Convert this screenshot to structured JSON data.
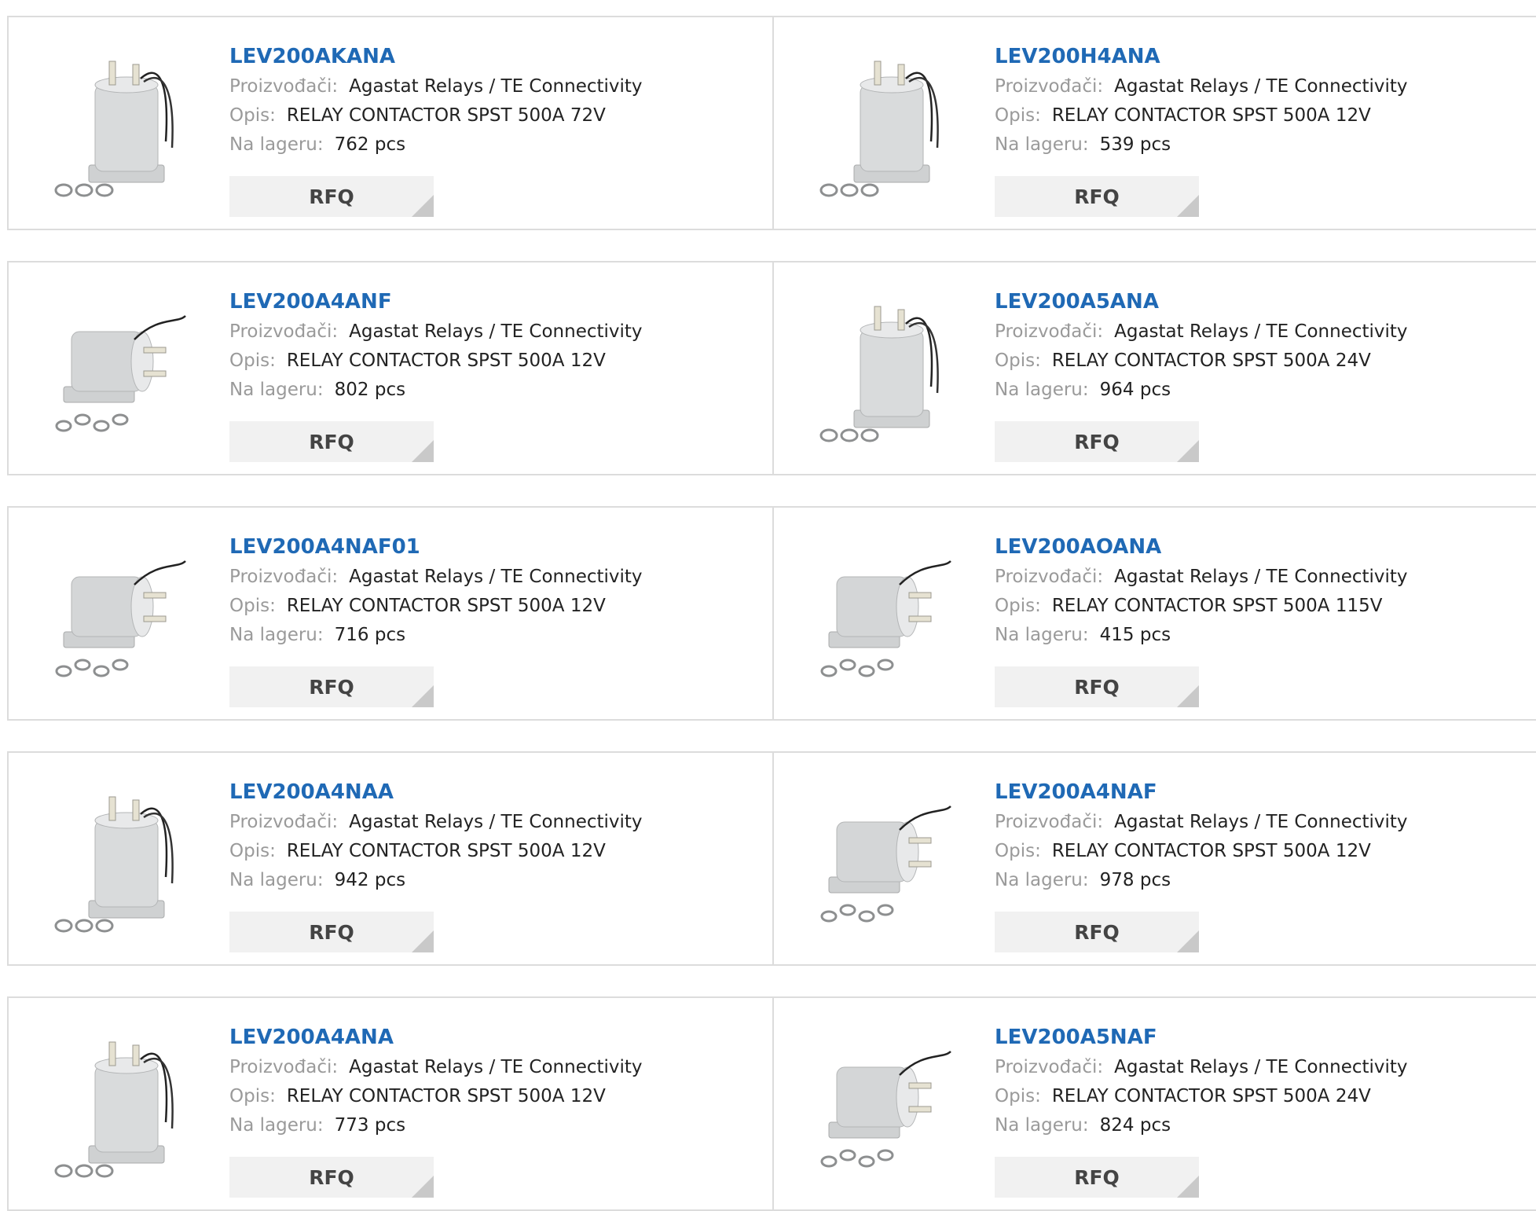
{
  "labels": {
    "manufacturer": "Proizvođači:",
    "description": "Opis:",
    "stock": "Na lageru:",
    "rfq": "RFQ"
  },
  "products": [
    {
      "part": "LEV200AKANA",
      "manufacturer": "Agastat Relays / TE Connectivity",
      "description": "RELAY CONTACTOR SPST 500A 72V",
      "stock": "762 pcs"
    },
    {
      "part": "LEV200H4ANA",
      "manufacturer": "Agastat Relays / TE Connectivity",
      "description": "RELAY CONTACTOR SPST 500A 12V",
      "stock": "539 pcs"
    },
    {
      "part": "LEV200A4ANF",
      "manufacturer": "Agastat Relays / TE Connectivity",
      "description": "RELAY CONTACTOR SPST 500A 12V",
      "stock": "802 pcs"
    },
    {
      "part": "LEV200A5ANA",
      "manufacturer": "Agastat Relays / TE Connectivity",
      "description": "RELAY CONTACTOR SPST 500A 24V",
      "stock": "964 pcs"
    },
    {
      "part": "LEV200A4NAF01",
      "manufacturer": "Agastat Relays / TE Connectivity",
      "description": "RELAY CONTACTOR SPST 500A 12V",
      "stock": "716 pcs"
    },
    {
      "part": "LEV200AOANA",
      "manufacturer": "Agastat Relays / TE Connectivity",
      "description": "RELAY CONTACTOR SPST 500A 115V",
      "stock": "415 pcs"
    },
    {
      "part": "LEV200A4NAA",
      "manufacturer": "Agastat Relays / TE Connectivity",
      "description": "RELAY CONTACTOR SPST 500A 12V",
      "stock": "942 pcs"
    },
    {
      "part": "LEV200A4NAF",
      "manufacturer": "Agastat Relays / TE Connectivity",
      "description": "RELAY CONTACTOR SPST 500A 12V",
      "stock": "978 pcs"
    },
    {
      "part": "LEV200A4ANA",
      "manufacturer": "Agastat Relays / TE Connectivity",
      "description": "RELAY CONTACTOR SPST 500A 12V",
      "stock": "773 pcs"
    },
    {
      "part": "LEV200A5NAF",
      "manufacturer": "Agastat Relays / TE Connectivity",
      "description": "RELAY CONTACTOR SPST 500A 24V",
      "stock": "824 pcs"
    }
  ],
  "colors": {
    "part_link": "#1f69b5",
    "label": "#9a9a9a",
    "border": "#dcdcdc",
    "rfq_bg": "#f1f1f1"
  }
}
